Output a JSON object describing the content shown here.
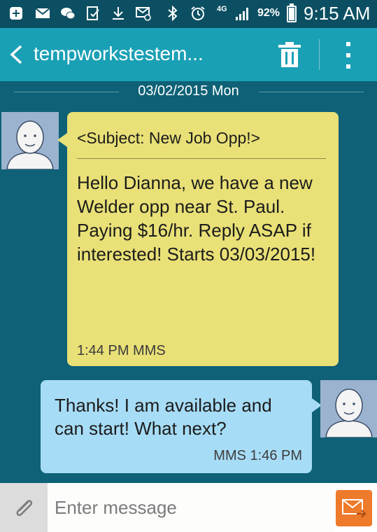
{
  "status_bar": {
    "icons": [
      "add-icon",
      "email-icon",
      "wechat-icon",
      "clipboard-icon",
      "download-icon",
      "mail-at-icon",
      "bluetooth-icon",
      "alarm-icon",
      "4g-network-icon",
      "signal-icon"
    ],
    "network_label": "4G",
    "battery_percent": "92%",
    "battery_level": 0.92,
    "time": "9:15 AM"
  },
  "app_bar": {
    "title": "tempworkstestem...",
    "icons": [
      "back-arrow-icon",
      "trash-icon",
      "more-options-icon"
    ]
  },
  "conversation": {
    "date_separator": "03/02/2015 Mon",
    "messages": [
      {
        "direction": "incoming",
        "subject": "<Subject: New Job Opp!>",
        "text": "Hello Dianna, we have a new Welder opp near St. Paul. Paying $16/hr. Reply ASAP if interested! Starts 03/03/2015!",
        "meta": "1:44 PM MMS"
      },
      {
        "direction": "outgoing",
        "text": "Thanks! I am available and can start! What next?",
        "meta": "MMS 1:46 PM"
      }
    ]
  },
  "composer": {
    "placeholder": "Enter message",
    "value": "",
    "icons": [
      "paperclip-icon",
      "send-mms-icon"
    ]
  },
  "colors": {
    "status_bar": "#0c4f62",
    "app_bar": "#1aa0b5",
    "background": "#0e6176",
    "incoming_bubble": "#e9e077",
    "outgoing_bubble": "#a7dcf6",
    "send_button": "#ee7a2b",
    "avatar": "#9bb3cf"
  }
}
